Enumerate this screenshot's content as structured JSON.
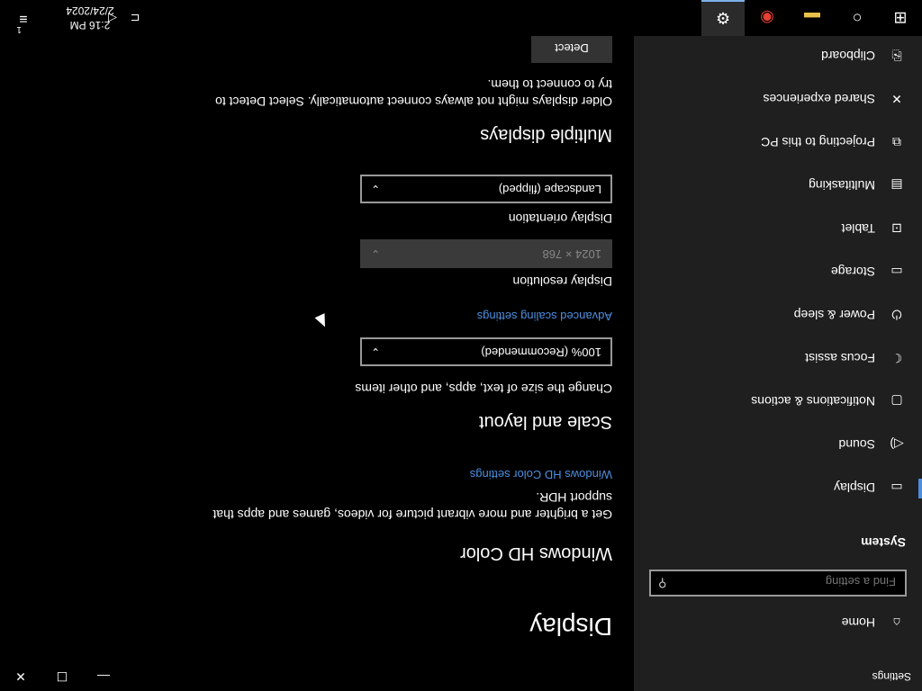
{
  "window": {
    "title": "Settings",
    "minimize_glyph": "—",
    "maximize_glyph": "☐",
    "close_glyph": "✕"
  },
  "sidebar": {
    "home_label": "Home",
    "home_icon": "⌂",
    "search_placeholder": "Find a setting",
    "search_icon": "⚲",
    "section": "System",
    "items": [
      {
        "label": "Display",
        "icon": "▭"
      },
      {
        "label": "Sound",
        "icon": "◁)"
      },
      {
        "label": "Notifications & actions",
        "icon": "▢"
      },
      {
        "label": "Focus assist",
        "icon": "☾"
      },
      {
        "label": "Power & sleep",
        "icon": "⏻"
      },
      {
        "label": "Storage",
        "icon": "▭"
      },
      {
        "label": "Tablet",
        "icon": "⊡"
      },
      {
        "label": "Multitasking",
        "icon": "▤"
      },
      {
        "label": "Projecting to this PC",
        "icon": "⧉"
      },
      {
        "label": "Shared experiences",
        "icon": "✕"
      },
      {
        "label": "Clipboard",
        "icon": "⎘"
      }
    ]
  },
  "main": {
    "title": "Display",
    "hd_heading": "Windows HD Color",
    "hd_desc_1": "Get a brighter and more vibrant picture for videos, games and apps that",
    "hd_desc_2": "support HDR.",
    "hd_link": "Windows HD Color settings",
    "scale_heading": "Scale and layout",
    "scale_label": "Change the size of text, apps, and other items",
    "scale_value": "100% (Recommended)",
    "advanced_link": "Advanced scaling settings",
    "resolution_label": "Display resolution",
    "resolution_value": "1024 × 768",
    "orientation_label": "Display orientation",
    "orientation_value": "Landscape (flipped)",
    "multi_heading": "Multiple displays",
    "multi_desc_1": "Older displays might not always connect automatically. Select Detect to",
    "multi_desc_2": "try to connect to them.",
    "detect_label": "Detect",
    "chevron": "⌄"
  },
  "taskbar": {
    "start_icon": "⊞",
    "search_icon": "○",
    "explorer_icon": "▬",
    "chrome_icon": "◉",
    "settings_icon": "⚙",
    "network_icon": "⊏",
    "volume_icon": "◁",
    "time": "2:16 PM",
    "date": "2/24/2024",
    "notification_icon": "≡",
    "notification_badge": "1"
  },
  "colors": {
    "accent": "#4c8fe0",
    "sidebar_bg": "#1f1f1f",
    "page_bg": "#000000"
  }
}
